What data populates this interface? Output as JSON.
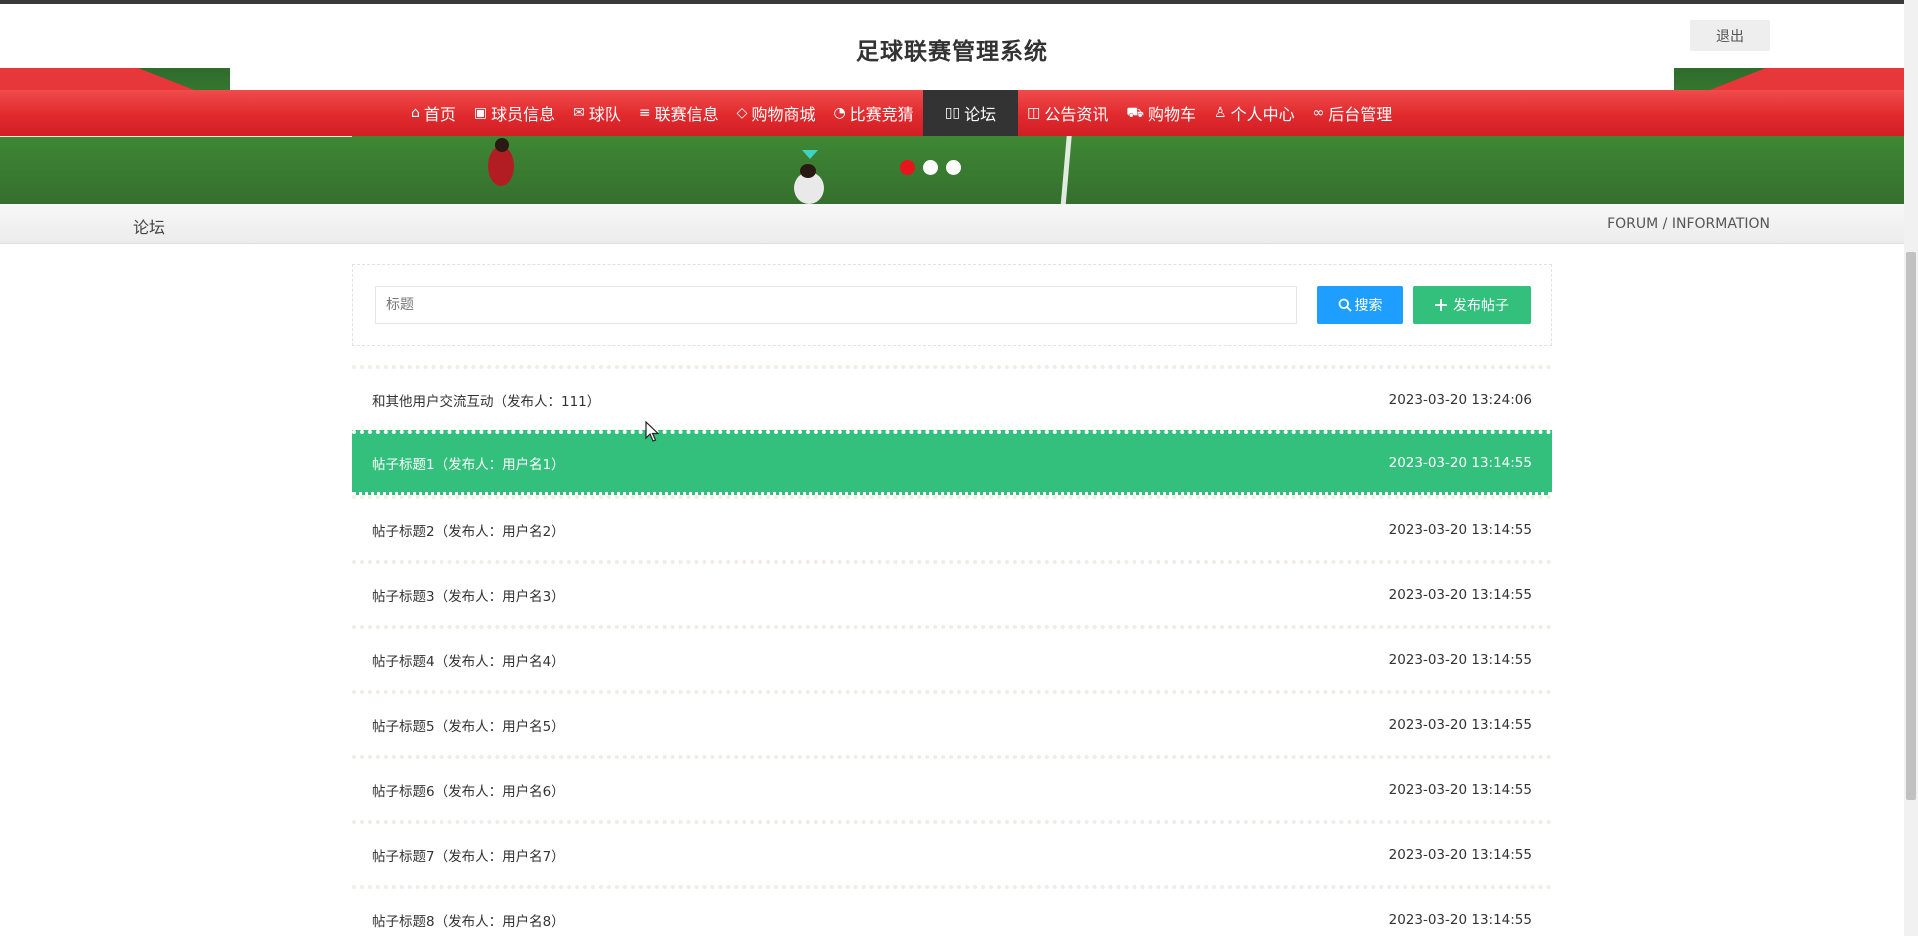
{
  "header": {
    "title": "足球联赛管理系统",
    "logout_label": "退出"
  },
  "nav": {
    "items": [
      {
        "icon": "home-icon",
        "glyph": "⌂",
        "label": "首页"
      },
      {
        "icon": "gift-icon",
        "glyph": "▣",
        "label": "球员信息"
      },
      {
        "icon": "mail-icon",
        "glyph": "✉",
        "label": "球队"
      },
      {
        "icon": "sliders-icon",
        "glyph": "≡",
        "label": "联赛信息"
      },
      {
        "icon": "tag-icon",
        "glyph": "◇",
        "label": "购物商城"
      },
      {
        "icon": "palette-icon",
        "glyph": "◔",
        "label": "比赛竞猜"
      },
      {
        "icon": "book-open-icon",
        "glyph": "▯▯",
        "label": "论坛",
        "active": true
      },
      {
        "icon": "reader-icon",
        "glyph": "◫",
        "label": "公告资讯"
      },
      {
        "icon": "cart-icon",
        "glyph": "⛟",
        "label": "购物车"
      },
      {
        "icon": "user-icon",
        "glyph": "♙",
        "label": "个人中心"
      },
      {
        "icon": "link-icon",
        "glyph": "∞",
        "label": "后台管理"
      }
    ]
  },
  "carousel": {
    "count": 3,
    "active_index": 0
  },
  "breadcrumb": {
    "current": "论坛",
    "right_text": "FORUM / INFORMATION"
  },
  "search": {
    "placeholder": "标题",
    "search_label": "搜索",
    "post_label": "发布帖子"
  },
  "posts": [
    {
      "title": "和其他用户交流互动（发布人：111）",
      "time": "2023-03-20 13:24:06"
    },
    {
      "title": "帖子标题1（发布人：用户名1）",
      "time": "2023-03-20 13:14:55",
      "hover": true
    },
    {
      "title": "帖子标题2（发布人：用户名2）",
      "time": "2023-03-20 13:14:55"
    },
    {
      "title": "帖子标题3（发布人：用户名3）",
      "time": "2023-03-20 13:14:55"
    },
    {
      "title": "帖子标题4（发布人：用户名4）",
      "time": "2023-03-20 13:14:55"
    },
    {
      "title": "帖子标题5（发布人：用户名5）",
      "time": "2023-03-20 13:14:55"
    },
    {
      "title": "帖子标题6（发布人：用户名6）",
      "time": "2023-03-20 13:14:55"
    },
    {
      "title": "帖子标题7（发布人：用户名7）",
      "time": "2023-03-20 13:14:55"
    },
    {
      "title": "帖子标题8（发布人：用户名8）",
      "time": "2023-03-20 13:14:55"
    }
  ],
  "colors": {
    "nav_red": "#e02a2e",
    "nav_active": "#333333",
    "primary_blue": "#1e9fff",
    "primary_green": "#33c07c",
    "dot_active": "#e8151c"
  }
}
